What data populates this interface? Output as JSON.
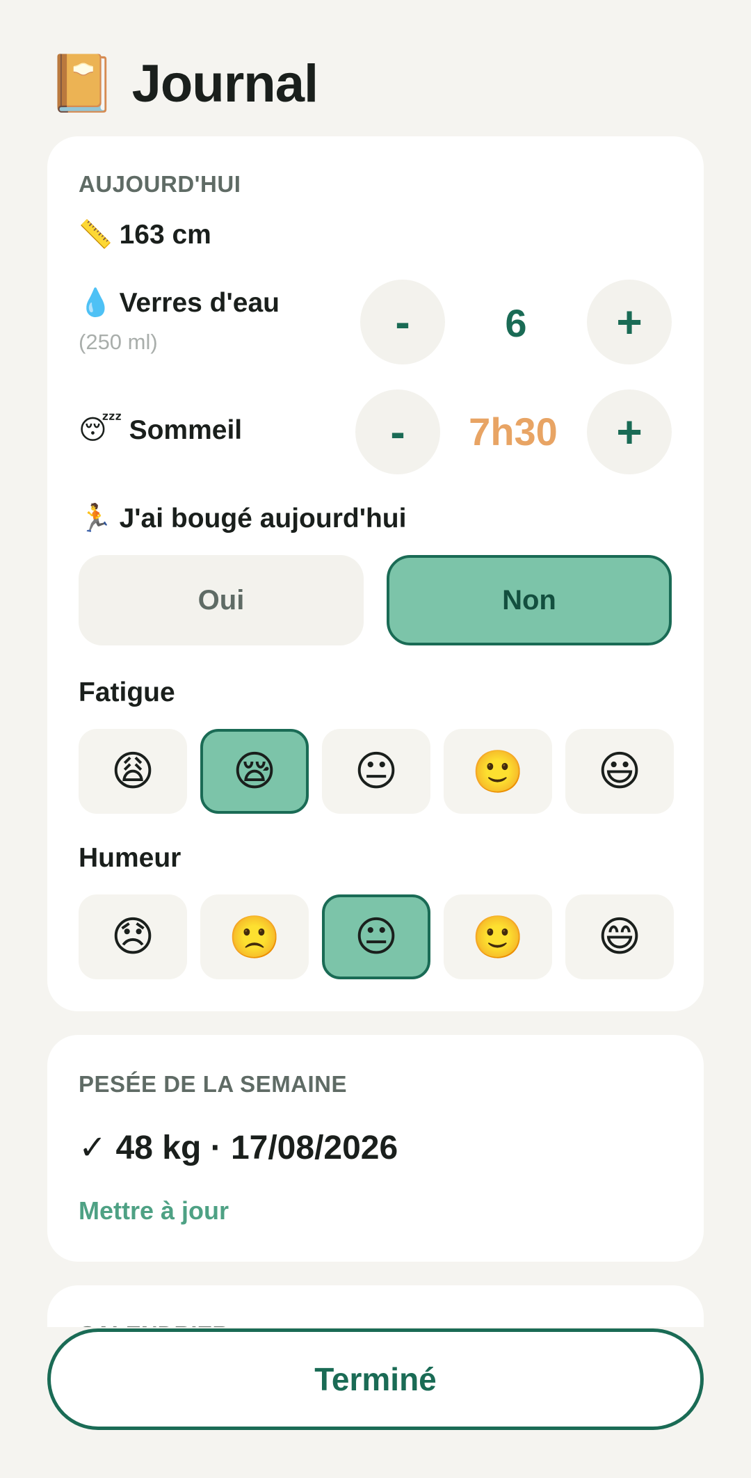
{
  "header": {
    "icon": "📔",
    "title": "Journal"
  },
  "today": {
    "section_label": "AUJOURD'HUI",
    "height": {
      "icon": "📏",
      "text": "163 cm"
    },
    "water": {
      "icon": "💧",
      "label": "Verres d'eau",
      "sublabel": "(250 ml)",
      "minus": "-",
      "value": "6",
      "plus": "+"
    },
    "sleep": {
      "icon": "😴",
      "label": "Sommeil",
      "minus": "-",
      "value": "7h30",
      "plus": "+"
    },
    "moved": {
      "icon": "🏃",
      "label": "J'ai bougé aujourd'hui",
      "options": [
        "Oui",
        "Non"
      ],
      "selected": "Non"
    },
    "fatigue": {
      "label": "Fatigue",
      "options": [
        "😩",
        "😪",
        "😐",
        "🙂",
        "😃"
      ],
      "selected_index": 1
    },
    "mood": {
      "label": "Humeur",
      "options": [
        "😞",
        "🙁",
        "😐",
        "🙂",
        "😄"
      ],
      "selected_index": 2
    }
  },
  "weigh": {
    "section_label": "PESÉE DE LA SEMAINE",
    "value_line": "✓ 48 kg · 17/08/2026",
    "update_link": "Mettre à jour"
  },
  "calendar": {
    "section_label": "CALENDRIER"
  },
  "footer": {
    "done_label": "Terminé"
  },
  "colors": {
    "accent": "#1a6b55",
    "accent_light": "#7cc4a9",
    "sleep_value": "#e8a464",
    "background": "#f5f4f0"
  }
}
